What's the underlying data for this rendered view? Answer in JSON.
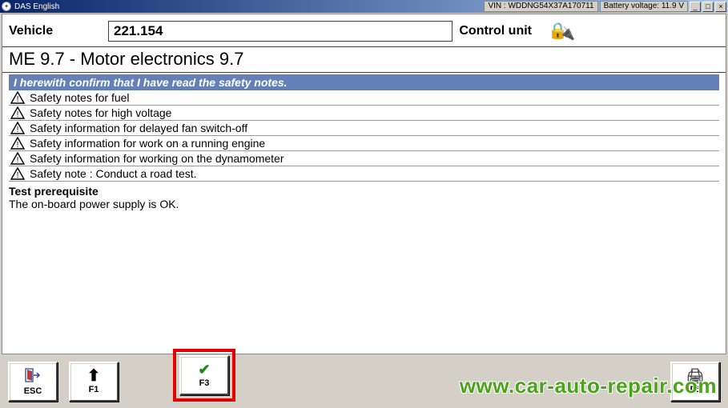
{
  "window": {
    "title": "DAS English",
    "vin_label": "VIN : WDDNG54X37A170711",
    "battery_label": "Battery voltage: 11.9 V"
  },
  "header": {
    "vehicle_label": "Vehicle",
    "vehicle_value": "221.154",
    "control_unit_label": "Control unit"
  },
  "ecu_title": "ME 9.7 - Motor electronics 9.7",
  "confirm_text": "I herewith confirm that I have read the safety notes.",
  "safety_notes": [
    "Safety notes for fuel",
    "Safety notes for high voltage",
    "Safety information for delayed fan switch-off",
    "Safety information for work on a running engine",
    "Safety information for working on the dynamometer",
    "Safety note : Conduct a road test."
  ],
  "test_prereq": {
    "heading": "Test prerequisite",
    "body": "The on-board power supply is OK."
  },
  "footer": {
    "esc": "ESC",
    "f1": "F1",
    "f3": "F3",
    "f5": "F5"
  },
  "watermark": "www.car-auto-repair.com"
}
